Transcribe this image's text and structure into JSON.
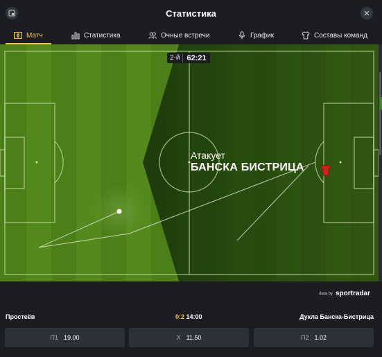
{
  "header": {
    "title": "Статистика"
  },
  "tabs": [
    {
      "label": "Матч",
      "icon": "pitch-icon",
      "active": true
    },
    {
      "label": "Статистика",
      "icon": "bar-chart-icon",
      "active": false
    },
    {
      "label": "Очные встречи",
      "icon": "users-icon",
      "active": false
    },
    {
      "label": "График",
      "icon": "microphone-icon",
      "active": false
    },
    {
      "label": "Составы команд",
      "icon": "shirt-icon",
      "active": false
    }
  ],
  "pitch": {
    "period": "2-й",
    "clock": "62:21",
    "attack_label": "Атакует",
    "attacking_team": "БАНСКА БИСТРИЦА"
  },
  "provider": {
    "prefix": "data by",
    "brand": "sportradar"
  },
  "match": {
    "home_team": "Простеёв",
    "away_team": "Дукла Банска-Бистрица",
    "score": "0:2",
    "kickoff": "14:00"
  },
  "odds": [
    {
      "label": "П1",
      "value": "19.00"
    },
    {
      "label": "Х",
      "value": "11.50"
    },
    {
      "label": "П2",
      "value": "1.02"
    }
  ],
  "colors": {
    "accent": "#f4c54a",
    "pitch": "#3f6c12",
    "background": "#1b1d22",
    "shirt": "#d0211b"
  }
}
